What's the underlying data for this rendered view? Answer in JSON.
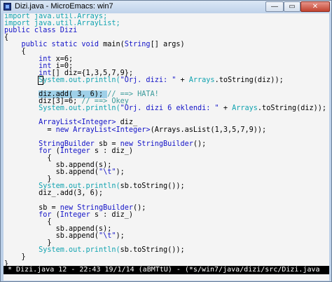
{
  "window": {
    "title": "Dizi.java - MicroEmacs: win7",
    "minimize_glyph": "—",
    "maximize_glyph": "▭",
    "close_glyph": "✕",
    "icon": "microemacs-app-icon"
  },
  "code": {
    "lines": [
      [
        {
          "c": "imp",
          "t": "import java.util.Arrays;"
        }
      ],
      [
        {
          "c": "imp",
          "t": "import java.util.ArrayList;"
        }
      ],
      [
        {
          "c": "kw",
          "t": "public class "
        },
        {
          "c": "typ",
          "t": "Dizi"
        }
      ],
      [
        {
          "c": "",
          "t": "{"
        }
      ],
      [
        {
          "c": "",
          "t": "    "
        },
        {
          "c": "kw",
          "t": "public static void "
        },
        {
          "c": "",
          "t": "main("
        },
        {
          "c": "typ",
          "t": "String"
        },
        {
          "c": "",
          "t": "[] args)"
        }
      ],
      [
        {
          "c": "",
          "t": "    {"
        }
      ],
      [
        {
          "c": "",
          "t": "        "
        },
        {
          "c": "kw",
          "t": "int "
        },
        {
          "c": "",
          "t": "x=6;"
        }
      ],
      [
        {
          "c": "",
          "t": "        "
        },
        {
          "c": "kw",
          "t": "int "
        },
        {
          "c": "",
          "t": "i=0;"
        }
      ],
      [
        {
          "c": "",
          "t": "        "
        },
        {
          "c": "kw",
          "t": "int"
        },
        {
          "c": "",
          "t": "[] diz={1,3,5,7,9};"
        }
      ],
      [
        {
          "c": "",
          "t": "        "
        },
        {
          "c": "fn",
          "t": "System.out.println("
        },
        {
          "c": "str",
          "t": "\"Orj. dizi: \""
        },
        {
          "c": "",
          "t": " + "
        },
        {
          "c": "fn",
          "t": "Arrays"
        },
        {
          "c": "",
          "t": ".toString(diz));"
        }
      ],
      [
        {
          "c": "",
          "t": ""
        }
      ],
      [
        {
          "c": "",
          "t": "        "
        },
        {
          "c": "sel",
          "t": "diz.add( 3, 6); "
        },
        {
          "c": "cmt",
          "t": "// ==> HATA!"
        }
      ],
      [
        {
          "c": "",
          "t": "        diz[3]=6; "
        },
        {
          "c": "cmt",
          "t": "// ==> Okey"
        }
      ],
      [
        {
          "c": "",
          "t": "        "
        },
        {
          "c": "fn",
          "t": "System.out.println("
        },
        {
          "c": "str",
          "t": "\"Orj. dizi 6 eklendi: \""
        },
        {
          "c": "",
          "t": " + "
        },
        {
          "c": "fn",
          "t": "Arrays"
        },
        {
          "c": "",
          "t": ".toString(diz));"
        }
      ],
      [
        {
          "c": "",
          "t": ""
        }
      ],
      [
        {
          "c": "",
          "t": "        "
        },
        {
          "c": "typ",
          "t": "ArrayList<Integer>"
        },
        {
          "c": "",
          "t": " diz_"
        }
      ],
      [
        {
          "c": "",
          "t": "          = "
        },
        {
          "c": "kw",
          "t": "new "
        },
        {
          "c": "typ",
          "t": "ArrayList<Integer>"
        },
        {
          "c": "",
          "t": "(Arrays.asList(1,3,5,7,9));"
        }
      ],
      [
        {
          "c": "",
          "t": ""
        }
      ],
      [
        {
          "c": "",
          "t": "        "
        },
        {
          "c": "typ",
          "t": "StringBuilder"
        },
        {
          "c": "",
          "t": " sb = "
        },
        {
          "c": "kw",
          "t": "new "
        },
        {
          "c": "typ",
          "t": "StringBuilder"
        },
        {
          "c": "",
          "t": "();"
        }
      ],
      [
        {
          "c": "",
          "t": "        "
        },
        {
          "c": "kw",
          "t": "for "
        },
        {
          "c": "",
          "t": "("
        },
        {
          "c": "typ",
          "t": "Integer"
        },
        {
          "c": "",
          "t": " s : diz_)"
        }
      ],
      [
        {
          "c": "",
          "t": "          {"
        }
      ],
      [
        {
          "c": "",
          "t": "            sb.append(s);"
        }
      ],
      [
        {
          "c": "",
          "t": "            sb.append("
        },
        {
          "c": "str",
          "t": "\"\\t\""
        },
        {
          "c": "",
          "t": ");"
        }
      ],
      [
        {
          "c": "",
          "t": "          }"
        }
      ],
      [
        {
          "c": "",
          "t": "        "
        },
        {
          "c": "fn",
          "t": "System.out.println("
        },
        {
          "c": "",
          "t": "sb.toString());"
        }
      ],
      [
        {
          "c": "",
          "t": "        diz_.add(3, 6);"
        }
      ],
      [
        {
          "c": "",
          "t": ""
        }
      ],
      [
        {
          "c": "",
          "t": "        sb = "
        },
        {
          "c": "kw",
          "t": "new "
        },
        {
          "c": "typ",
          "t": "StringBuilder"
        },
        {
          "c": "",
          "t": "();"
        }
      ],
      [
        {
          "c": "",
          "t": "        "
        },
        {
          "c": "kw",
          "t": "for "
        },
        {
          "c": "",
          "t": "("
        },
        {
          "c": "typ",
          "t": "Integer"
        },
        {
          "c": "",
          "t": " s : diz_)"
        }
      ],
      [
        {
          "c": "",
          "t": "          {"
        }
      ],
      [
        {
          "c": "",
          "t": "            sb.append(s);"
        }
      ],
      [
        {
          "c": "",
          "t": "            sb.append("
        },
        {
          "c": "str",
          "t": "\"\\t\""
        },
        {
          "c": "",
          "t": ");"
        }
      ],
      [
        {
          "c": "",
          "t": "          }"
        }
      ],
      [
        {
          "c": "",
          "t": "        "
        },
        {
          "c": "fn",
          "t": "System.out.println("
        },
        {
          "c": "",
          "t": "sb.toString());"
        }
      ],
      [
        {
          "c": "",
          "t": "    }"
        }
      ],
      [
        {
          "c": "",
          "t": "}"
        }
      ]
    ]
  },
  "modeline": {
    "text": " * Dizi.java 12 - 22:43 19/1/14 (aBMTtU) - (*s/win7/java/dizi/src/Dizi.java"
  },
  "colors": {
    "keyword": "#1414c8",
    "import": "#11a3b0",
    "comment": "#3a9a9a",
    "modeline_bg": "#000000"
  }
}
